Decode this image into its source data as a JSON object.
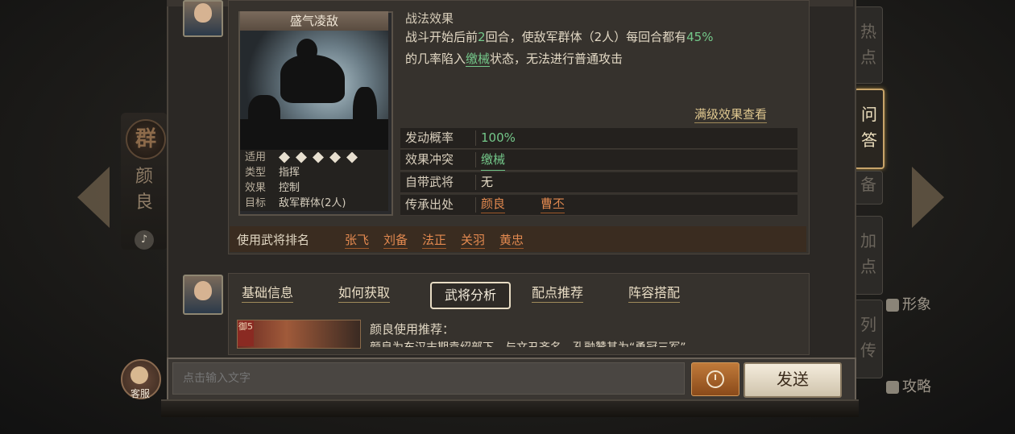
{
  "hero": {
    "name": "颜良",
    "faction_badge": "群"
  },
  "skill": {
    "title": "盛气凌敌",
    "section_heading": "战法效果",
    "desc_line1_a": "战斗开始后前",
    "desc_turns": "2",
    "desc_line1_b": "回合，使敌军群体（2人）每回合都有",
    "desc_prob": "45%",
    "desc_line2_a": "的几率陷入",
    "desc_status": "缴械",
    "desc_line2_b": "状态，无法进行普通攻击",
    "view_full_label": "满级效果查看",
    "attributes": [
      {
        "key": "适用",
        "value": ""
      },
      {
        "key": "类型",
        "value": "指挥"
      },
      {
        "key": "效果",
        "value": "控制"
      },
      {
        "key": "目标",
        "value": "敌军群体(2人)"
      }
    ],
    "unit_icons": [
      "cavalry-icon",
      "shield-icon",
      "archer-icon",
      "spear-icon",
      "siege-icon"
    ],
    "stats": [
      {
        "key": "发动概率",
        "value": "100%"
      },
      {
        "key": "效果冲突",
        "value": "缴械"
      },
      {
        "key": "自带武将",
        "value": "无"
      },
      {
        "key": "传承出处",
        "value": "颜良",
        "value2": "曹丕"
      }
    ],
    "generals_label": "使用武将排名",
    "generals": [
      "张飞",
      "刘备",
      "法正",
      "关羽",
      "黄忠"
    ]
  },
  "analysis": {
    "tabs": [
      "基础信息",
      "如何获取",
      "武将分析",
      "配点推荐",
      "阵容搭配"
    ],
    "active_tab": "武将分析",
    "card_badge": "御5",
    "recommend_title": "颜良使用推荐：",
    "recommend_text": "颜良为东汉末期袁绍部下，与文丑齐名，孔融赞其为“勇冠三军”"
  },
  "right_tabs": [
    "热点",
    "问答",
    "备",
    "加点",
    "列传"
  ],
  "side_links": {
    "image": "形象",
    "guide": "攻略"
  },
  "sound_icon": "speaker-icon",
  "chat": {
    "placeholder": "点击输入文字",
    "send_label": "发送",
    "service_label": "客服"
  },
  "colors": {
    "accent_green": "#74c88a",
    "accent_orange": "#e48a50",
    "gold": "#c8a46a"
  }
}
